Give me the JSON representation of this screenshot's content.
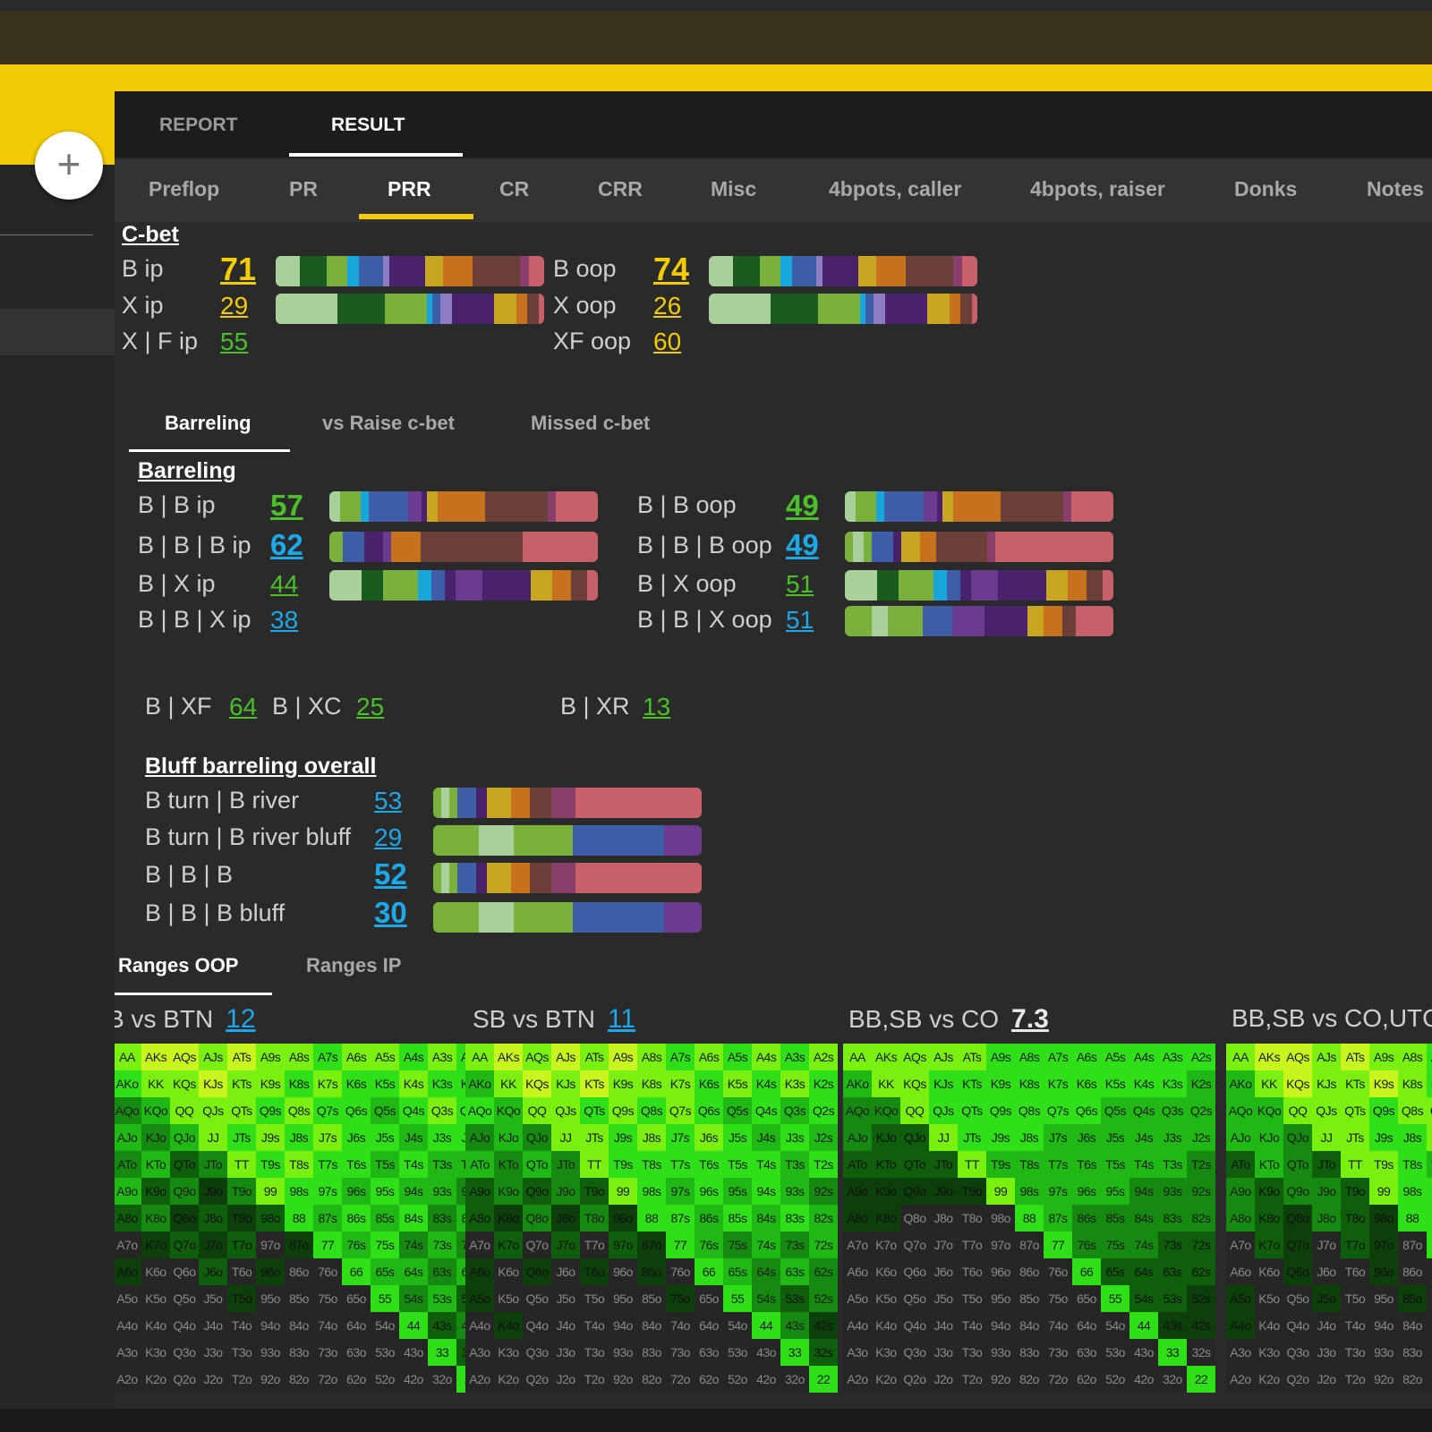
{
  "top_tabs": [
    "REPORT",
    "RESULT"
  ],
  "sub_tabs": [
    "Preflop",
    "PR",
    "PRR",
    "CR",
    "CRR",
    "Misc",
    "4bpots, caller",
    "4bpots, raiser",
    "Donks",
    "Notes"
  ],
  "cbet": {
    "title": "C-bet",
    "rows": [
      {
        "label": "B ip",
        "value": "71"
      },
      {
        "label": "X ip",
        "value": "29"
      },
      {
        "label": "X | F ip",
        "value": "55"
      },
      {
        "label": "B oop",
        "value": "74"
      },
      {
        "label": "X oop",
        "value": "26"
      },
      {
        "label": "XF oop",
        "value": "60"
      }
    ]
  },
  "c_tabs": [
    "Barreling",
    "vs Raise c-bet",
    "Missed c-bet"
  ],
  "barreling": {
    "title": "Barreling",
    "rows": [
      {
        "label": "B | B ip",
        "value": "57"
      },
      {
        "label": "B | B | B ip",
        "value": "62"
      },
      {
        "label": "B | X  ip",
        "value": "44"
      },
      {
        "label": "B | B | X ip",
        "value": "38"
      },
      {
        "label": "B | B oop",
        "value": "49"
      },
      {
        "label": "B | B | B oop",
        "value": "49"
      },
      {
        "label": "B | X oop",
        "value": "51"
      },
      {
        "label": "B | B | X oop",
        "value": "51"
      }
    ],
    "extra": [
      {
        "label": "B | XF",
        "value": "64"
      },
      {
        "label": "B | XC",
        "value": "25"
      },
      {
        "label": "B | XR",
        "value": "13"
      }
    ]
  },
  "bluff": {
    "title": "Bluff barreling overall",
    "rows": [
      {
        "label": "B turn | B river",
        "value": "53"
      },
      {
        "label": "B turn | B river bluff",
        "value": "29"
      },
      {
        "label": "B | B | B",
        "value": "52"
      },
      {
        "label": "B | B | B bluff",
        "value": "30"
      }
    ]
  },
  "range_tabs": [
    "Ranges OOP",
    "Ranges IP"
  ],
  "ranges": [
    {
      "title": "B vs BTN",
      "value": "12"
    },
    {
      "title": "SB vs BTN",
      "value": "11"
    },
    {
      "title": "BB,SB vs CO",
      "value": "7.3"
    },
    {
      "title": "BB,SB vs CO,UTG",
      "value": ""
    }
  ],
  "colors": {
    "accent": "#f2cb05",
    "green_value": "#4cc02a",
    "blue_value": "#1ea8e8",
    "panel_bg": "#2a2a2a"
  },
  "icons": [
    "plus-icon"
  ]
}
